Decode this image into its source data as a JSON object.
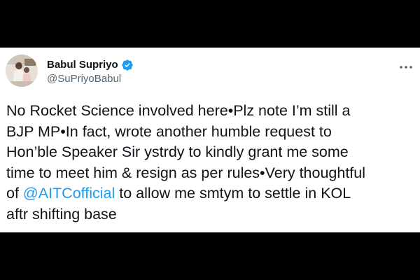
{
  "tweet": {
    "display_name": "Babul Supriyo",
    "handle": "@SuPriyoBabul",
    "lines": {
      "l1": "No Rocket Science involved here•Plz note I’m still a",
      "l2": "BJP MP•In fact, wrote another humble request to",
      "l3": "Hon’ble Speaker Sir ystrdy to kindly grant me some",
      "l4": "time to meet him & resign as per rules•Very thoughtful",
      "l5_prefix": "of ",
      "l5_mention": "@AITCofficial",
      "l5_suffix": " to allow me smtym to settle in KOL",
      "l6": "aftr shifting base"
    }
  },
  "icons": {
    "verified": "verified-badge-icon",
    "more": "more-options-icon"
  },
  "colors": {
    "accent": "#1d9bf0",
    "text": "#0f1419",
    "secondary": "#536471",
    "background": "#ffffff",
    "letterbox": "#000000"
  }
}
